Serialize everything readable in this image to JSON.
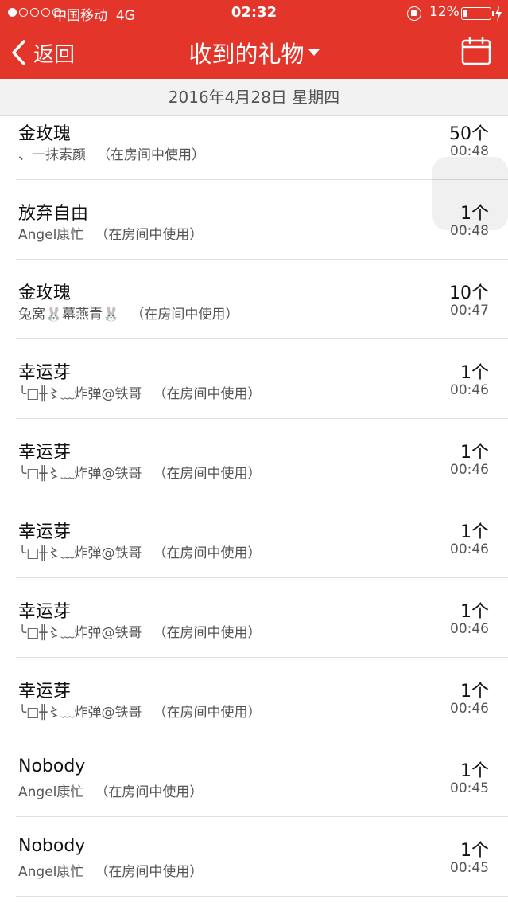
{
  "status_bar": {
    "carrier": "中国移动",
    "network": "4G",
    "time": "02:32",
    "battery_percent": "12%",
    "battery_level": 0.12,
    "signal_bars_filled": 1,
    "signal_bars_total": 5
  },
  "nav": {
    "back_label": "返回",
    "title": "收到的礼物"
  },
  "date_header": "2016年4月28日 星期四",
  "gifts": [
    {
      "name": "金玫瑰",
      "sender": "、一抹素颜",
      "usage": "（在房间中使用）",
      "count": "50个",
      "time": "00:48"
    },
    {
      "name": "放弃自由",
      "sender": "Angel康忙",
      "usage": "（在房间中使用）",
      "count": "1个",
      "time": "00:48"
    },
    {
      "name": "金玫瑰",
      "sender": "兔窝🐰幕燕青🐰",
      "usage": "（在房间中使用）",
      "count": "10个",
      "time": "00:47"
    },
    {
      "name": "幸运芽",
      "sender": "╰□╫〻﹏炸弹@铁哥",
      "usage": "（在房间中使用）",
      "count": "1个",
      "time": "00:46"
    },
    {
      "name": "幸运芽",
      "sender": "╰□╫〻﹏炸弹@铁哥",
      "usage": "（在房间中使用）",
      "count": "1个",
      "time": "00:46"
    },
    {
      "name": "幸运芽",
      "sender": "╰□╫〻﹏炸弹@铁哥",
      "usage": "（在房间中使用）",
      "count": "1个",
      "time": "00:46"
    },
    {
      "name": "幸运芽",
      "sender": "╰□╫〻﹏炸弹@铁哥",
      "usage": "（在房间中使用）",
      "count": "1个",
      "time": "00:46"
    },
    {
      "name": "幸运芽",
      "sender": "╰□╫〻﹏炸弹@铁哥",
      "usage": "（在房间中使用）",
      "count": "1个",
      "time": "00:46"
    },
    {
      "name": "Nobody",
      "sender": "Angel康忙",
      "usage": "（在房间中使用）",
      "count": "1个",
      "time": "00:45"
    },
    {
      "name": "Nobody",
      "sender": "Angel康忙",
      "usage": "（在房间中使用）",
      "count": "1个",
      "time": "00:45"
    }
  ],
  "colors": {
    "brand_red": "#e4352b",
    "date_bar_bg": "#f2f2f2",
    "separator": "#e0e0e0"
  }
}
